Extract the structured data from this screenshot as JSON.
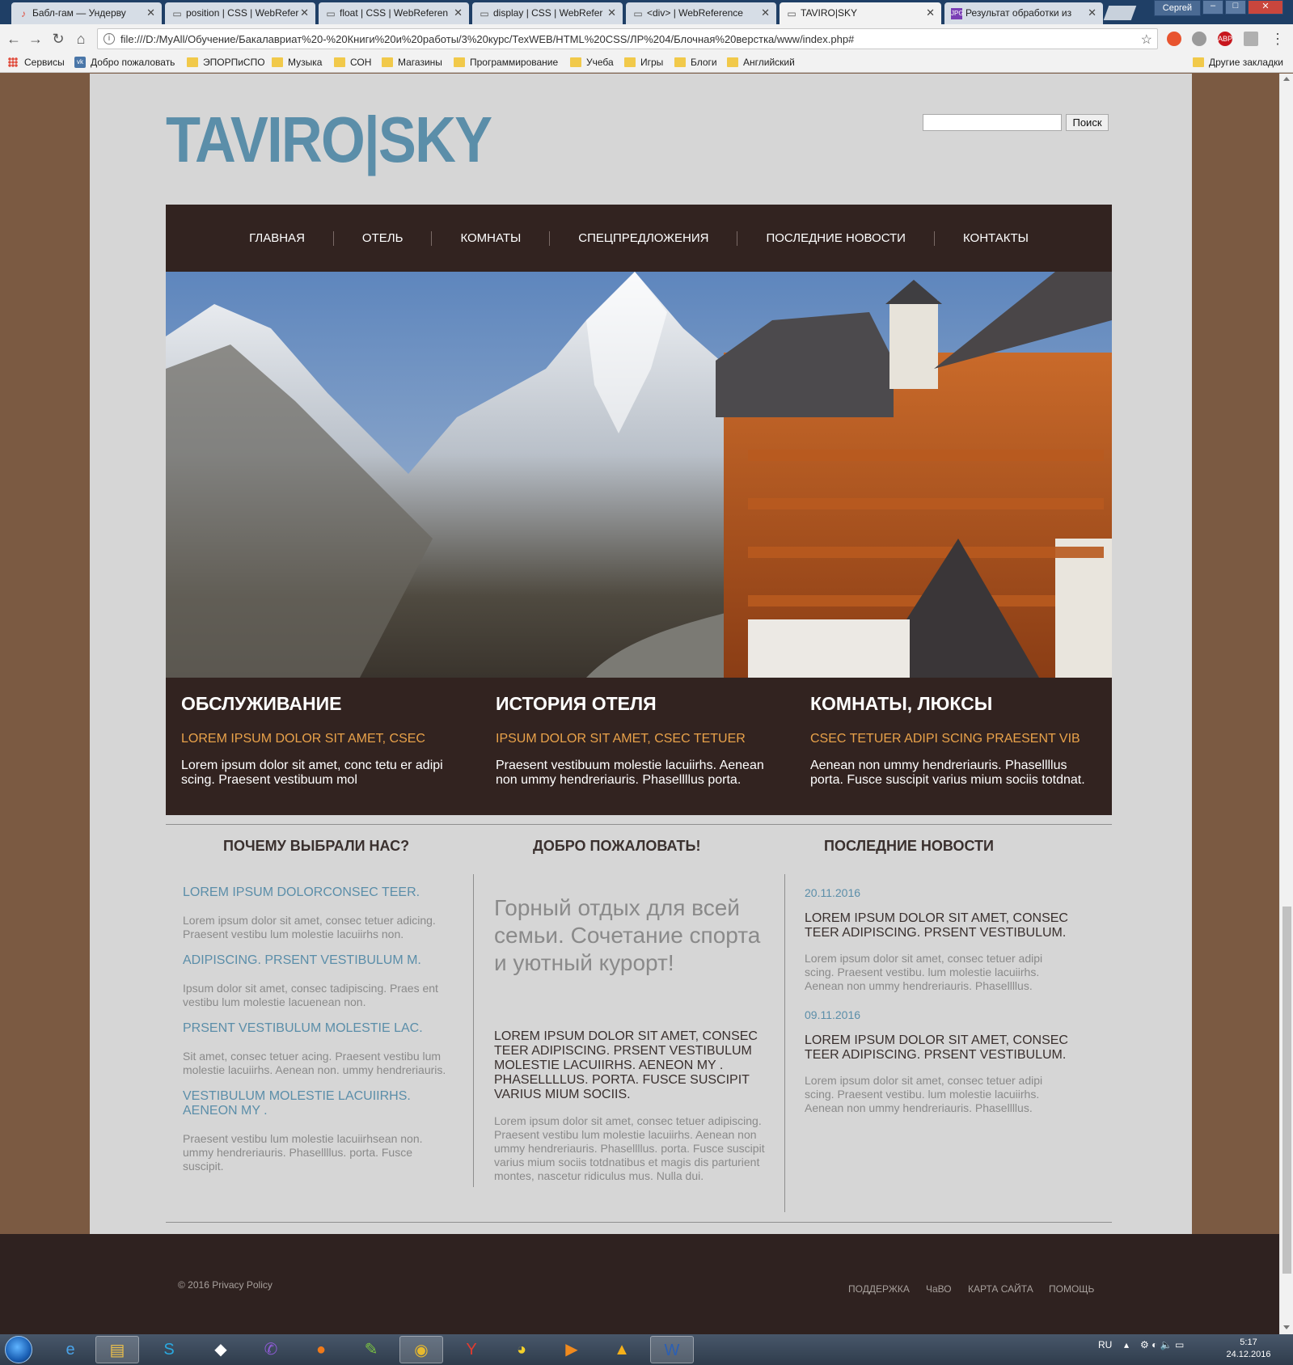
{
  "browser": {
    "tabs": [
      {
        "title": "Бабл-гам — Ундерву",
        "icon": "music-icon",
        "active": false
      },
      {
        "title": "position | CSS | WebRefer",
        "icon": "page-icon",
        "active": false
      },
      {
        "title": "float | CSS | WebReferen",
        "icon": "page-icon",
        "active": false
      },
      {
        "title": "display | CSS | WebRefer",
        "icon": "page-icon",
        "active": false
      },
      {
        "title": "<div> | WebReference",
        "icon": "page-icon",
        "active": false
      },
      {
        "title": "TAVIRO|SKY",
        "icon": "page-icon",
        "active": true
      },
      {
        "title": "Результат обработки из",
        "icon": "jpg-icon",
        "active": false
      }
    ],
    "user_label": "Сергей",
    "address": "file:///D:/MyAll/Обучение/Бакалавриат%20-%20Книги%20и%20работы/3%20курс/ТехWEB/HTML%20CSS/ЛР%204/Блочная%20верстка/www/index.php#",
    "bookmarks": [
      "Сервисы",
      "Добро пожаловать",
      "ЭПОРПиСПО",
      "Музыка",
      "СОН",
      "Магазины",
      "Программирование",
      "Учеба",
      "Игры",
      "Блоги",
      "Английский"
    ],
    "other_bookmarks": "Другие закладки",
    "extensions": [
      {
        "label": "",
        "color": "#e8542f"
      },
      {
        "label": "",
        "color": "#9a9a9a"
      },
      {
        "label": "ABP",
        "color": "#c7161d"
      },
      {
        "label": "",
        "color": "#b0b0b0"
      }
    ]
  },
  "site": {
    "logo": "TAVIRO|SKY",
    "search_button": "Поиск",
    "search_value": "",
    "menu": [
      "ГЛАВНАЯ",
      "ОТЕЛЬ",
      "КОМНАТЫ",
      "СПЕЦПРЕДЛОЖЕНИЯ",
      "ПОСЛЕДНИЕ НОВОСТИ",
      "КОНТАКТЫ"
    ],
    "features": [
      {
        "title": "ОБСЛУЖИВАНИЕ",
        "subtitle": "LOREM IPSUM DOLOR SIT AMET, CSEC",
        "text": "Lorem ipsum dolor sit amet, conc tetu er adipi scing. Praesent vestibuum mol"
      },
      {
        "title": "ИСТОРИЯ ОТЕЛЯ",
        "subtitle": "IPSUM DOLOR SIT AMET, CSEC TETUER",
        "text": "Praesent vestibuum molestie lacuiirhs. Aenean non ummy hendreriauris. Phasellllus porta."
      },
      {
        "title": "КОМНАТЫ, ЛЮКСЫ",
        "subtitle": "CSEC TETUER ADIPI SCING PRAESENT VIB",
        "text": "Aenean non ummy hendreriauris. Phasellllus porta. Fusce suscipit varius mium sociis totdnat."
      }
    ],
    "why": {
      "heading": "ПОЧЕМУ ВЫБРАЛИ НАС?",
      "items": [
        {
          "title": "LOREM IPSUM DOLORCONSEC TEER.",
          "text": "Lorem ipsum dolor sit amet, consec tetuer adicing. Praesent vestibu lum molestie lacuiirhs non."
        },
        {
          "title": "ADIPISCING. PRSENT VESTIBULUM M.",
          "text": "Ipsum dolor sit amet, consec tadipiscing. Praes ent vestibu lum molestie lacuenean non."
        },
        {
          "title": "PRSENT VESTIBULUM MOLESTIE LAC.",
          "text": "Sit amet, consec tetuer acing. Praesent vestibu lum molestie lacuiirhs. Aenean non. ummy hendreriauris."
        },
        {
          "title": "VESTIBULUM MOLESTIE LACUIIRHS. AENEON MY .",
          "text": "Praesent vestibu lum molestie lacuiirhsean non. ummy hendreriauris. Phasellllus. porta. Fusce suscipit."
        }
      ]
    },
    "welcome": {
      "heading": "ДОБРО ПОЖАЛОВАТЬ!",
      "big": "Горный отдых для всей семьи. Сочетание спорта и уютный курорт!",
      "caps": "LOREM IPSUM DOLOR SIT AMET, CONSEC TEER ADIPISCING. PRSENT VESTIBULUM MOLESTIE LACUIIRHS. AENEON MY . PHASELLLLUS. PORTA. FUSCE SUSCIPIT VARIUS MIUM SOCIIS.",
      "text": "Lorem ipsum dolor sit amet, consec tetuer adipiscing. Praesent vestibu lum molestie lacuiirhs. Aenean non ummy hendreriauris. Phasellllus. porta. Fusce suscipit varius mium sociis totdnatibus et magis dis parturient montes, nascetur ridiculus mus. Nulla dui."
    },
    "news": {
      "heading": "ПОСЛЕДНИЕ НОВОСТИ",
      "items": [
        {
          "date": "20.11.2016",
          "title": "LOREM IPSUM DOLOR SIT AMET, CONSEC TEER ADIPISCING. PRSENT VESTIBULUM.",
          "text": "Lorem ipsum dolor sit amet, consec tetuer adipi scing. Praesent vestibu. lum molestie lacuiirhs. Aenean non ummy hendreriauris. Phasellllus."
        },
        {
          "date": "09.11.2016",
          "title": "LOREM IPSUM DOLOR SIT AMET, CONSEC TEER ADIPISCING. PRSENT VESTIBULUM.",
          "text": "Lorem ipsum dolor sit amet, consec tetuer adipi scing. Praesent vestibu. lum molestie lacuiirhs. Aenean non ummy hendreriauris. Phasellllus."
        }
      ]
    },
    "footer": {
      "copyright": "© 2016 Privacy Policy",
      "links": [
        "ПОДДЕРЖКА",
        "ЧаВО",
        "КАРТА САЙТА",
        "ПОМОЩЬ"
      ]
    }
  },
  "taskbar": {
    "apps": [
      "internet-explorer-icon",
      "file-explorer-icon",
      "skype-icon",
      "app-icon",
      "viber-icon",
      "firefox-icon",
      "notepad-icon",
      "chrome-icon",
      "yandex-icon",
      "pacman-icon",
      "media-player-icon",
      "aimp-icon",
      "word-icon"
    ],
    "language": "RU",
    "time": "5:17",
    "date": "24.12.2016"
  }
}
